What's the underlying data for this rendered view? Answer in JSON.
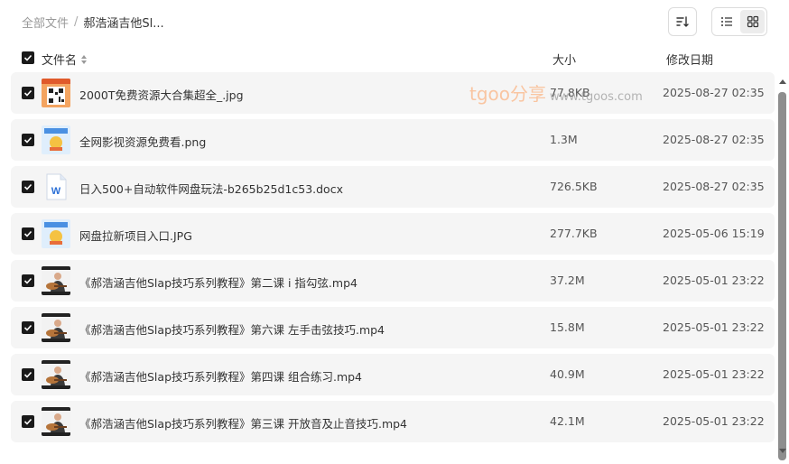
{
  "breadcrumb": {
    "root": "全部文件",
    "separator": "/",
    "current": "郝浩涵吉他Sl..."
  },
  "header": {
    "name": "文件名",
    "size": "大小",
    "date": "修改日期"
  },
  "watermark": {
    "text": "tgoo分享",
    "url": "www.tgoos.com"
  },
  "files": [
    {
      "name": "2000T免费资源大合集超全_.jpg",
      "size": "77.8KB",
      "date": "2025-08-27 02:35",
      "icon": "qr-image-thumbnail"
    },
    {
      "name": "全网影视资源免费看.png",
      "size": "1.3M",
      "date": "2025-08-27 02:35",
      "icon": "image-thumbnail"
    },
    {
      "name": "日入500+自动软件网盘玩法-b265b25d1c53.docx",
      "size": "726.5KB",
      "date": "2025-08-27 02:35",
      "icon": "word-doc-icon"
    },
    {
      "name": "网盘拉新项目入口.JPG",
      "size": "277.7KB",
      "date": "2025-05-06 15:19",
      "icon": "image-thumbnail"
    },
    {
      "name": "《郝浩涵吉他Slap技巧系列教程》第二课 i 指勾弦.mp4",
      "size": "37.2M",
      "date": "2025-05-01 23:22",
      "icon": "video-thumbnail"
    },
    {
      "name": "《郝浩涵吉他Slap技巧系列教程》第六课 左手击弦技巧.mp4",
      "size": "15.8M",
      "date": "2025-05-01 23:22",
      "icon": "video-thumbnail"
    },
    {
      "name": "《郝浩涵吉他Slap技巧系列教程》第四课 组合练习.mp4",
      "size": "40.9M",
      "date": "2025-05-01 23:22",
      "icon": "video-thumbnail"
    },
    {
      "name": "《郝浩涵吉他Slap技巧系列教程》第三课 开放音及止音技巧.mp4",
      "size": "42.1M",
      "date": "2025-05-01 23:22",
      "icon": "video-thumbnail"
    }
  ],
  "colors": {
    "row_bg": "#f5f5f5",
    "checkbox": "#1a1a1a",
    "watermark": "#ff8c3c"
  }
}
